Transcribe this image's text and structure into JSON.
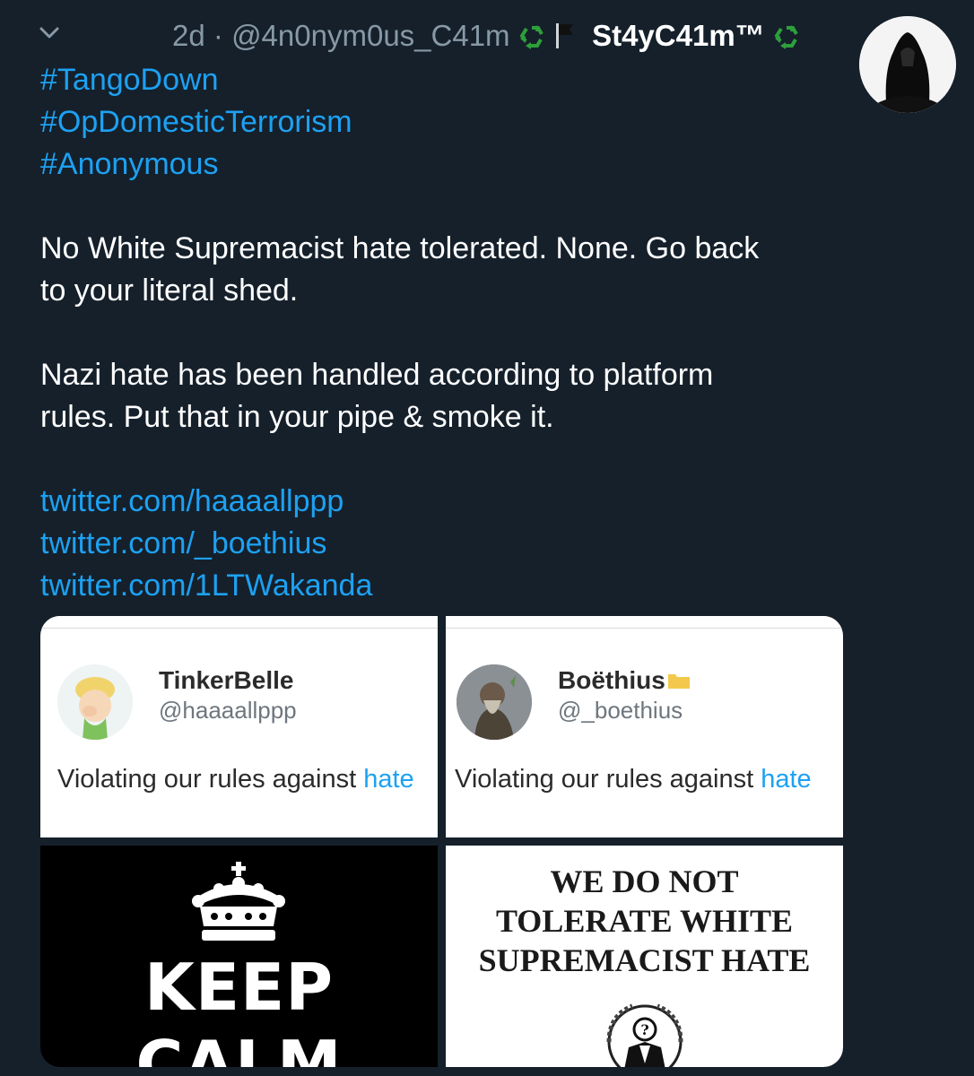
{
  "header": {
    "time": "2d",
    "separator": "·",
    "handle": "@4n0nym0us_C41m",
    "display_name": "St4yC41m™"
  },
  "tweet": {
    "hashtags": [
      "#TangoDown",
      "#OpDomesticTerrorism",
      "#Anonymous"
    ],
    "para1_line1": "No White Supremacist hate tolerated. None. Go back",
    "para1_line2": "to your literal shed.",
    "para2_line1": "Nazi hate has been handled according to platform",
    "para2_line2": "rules. Put that in your pipe & smoke it.",
    "links": [
      "twitter.com/haaaallppp",
      "twitter.com/_boethius",
      "twitter.com/1LTWakanda"
    ]
  },
  "media": {
    "card1": {
      "name": "TinkerBelle",
      "handle": "@haaaallppp",
      "text": "Violating our rules against ",
      "highlight": "hate"
    },
    "card2": {
      "name": "Boëthius",
      "handle": "@_boethius",
      "text": "Violating our rules against ",
      "highlight": "hate"
    },
    "keep_calm": {
      "line1": "KEEP",
      "line2": "CALM"
    },
    "poster": {
      "line1": "WE DO NOT",
      "line2": "TOLERATE WHITE",
      "line3": "SUPREMACIST HATE"
    }
  },
  "icons": [
    "chevron-down-icon",
    "recycle-icon",
    "black-flag-icon",
    "crown-icon",
    "anonymous-logo-icon",
    "folder-icon"
  ],
  "colors": {
    "background": "#15202b",
    "link": "#1da1f2",
    "muted": "#8899a6",
    "recycle": "#2e9f3a"
  }
}
